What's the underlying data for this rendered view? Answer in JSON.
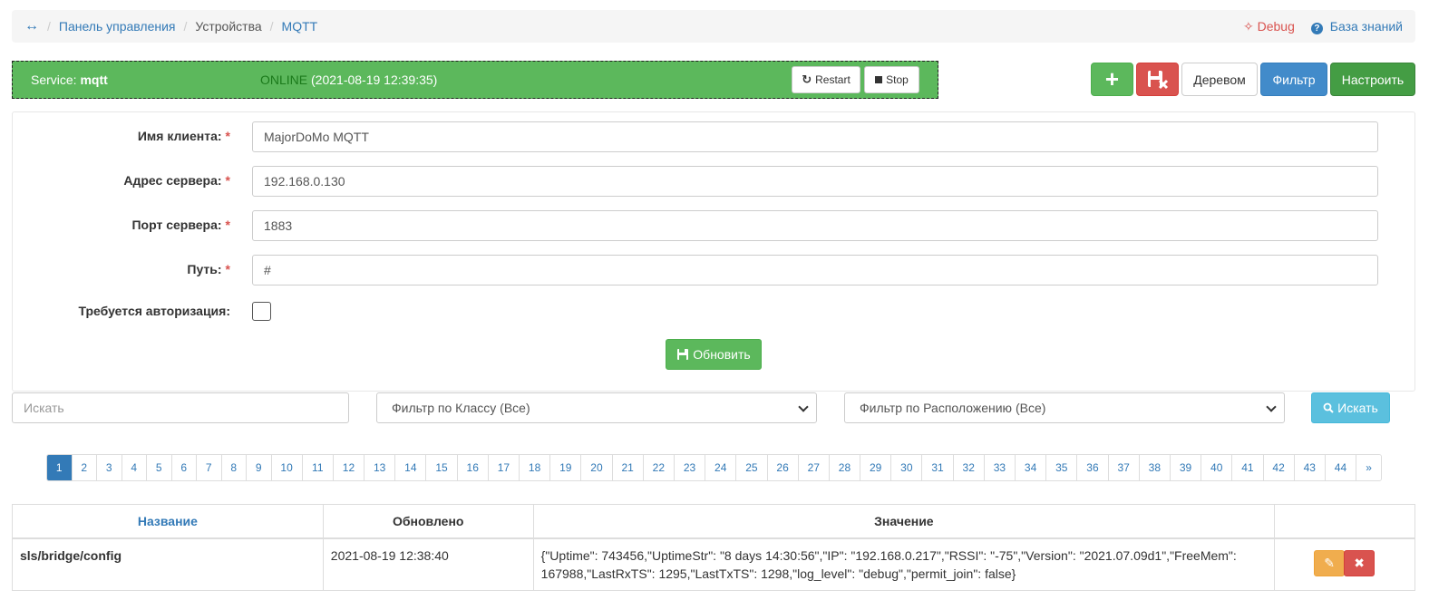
{
  "breadcrumb": {
    "home_icon": "arrows-horizontal-icon",
    "items": [
      "Панель управления",
      "Устройства",
      "MQTT"
    ],
    "debug": "Debug",
    "knowledge": "База знаний"
  },
  "service": {
    "label": "Service:",
    "name": "mqtt",
    "status": "ONLINE",
    "timestamp": "(2021-08-19 12:39:35)",
    "restart": "Restart",
    "stop": "Stop"
  },
  "toolbar": {
    "tree": "Деревом",
    "filter": "Фильтр",
    "setup": "Настроить"
  },
  "form": {
    "client_label": "Имя клиента:",
    "client_value": "MajorDoMo MQTT",
    "server_label": "Адрес сервера:",
    "server_value": "192.168.0.130",
    "port_label": "Порт сервера:",
    "port_value": "1883",
    "path_label": "Путь:",
    "path_value": "#",
    "auth_label": "Требуется авторизация:",
    "auth_checked": false,
    "update_button": "Обновить",
    "required_mark": "*"
  },
  "search": {
    "placeholder": "Искать",
    "class_filter": "Фильтр по Классу (Все)",
    "location_filter": "Фильтр по Расположению (Все)",
    "button": "Искать"
  },
  "pagination": {
    "active": "1",
    "pages": [
      "1",
      "2",
      "3",
      "4",
      "5",
      "6",
      "7",
      "8",
      "9",
      "10",
      "11",
      "12",
      "13",
      "14",
      "15",
      "16",
      "17",
      "18",
      "19",
      "20",
      "21",
      "22",
      "23",
      "24",
      "25",
      "26",
      "27",
      "28",
      "29",
      "30",
      "31",
      "32",
      "33",
      "34",
      "35",
      "36",
      "37",
      "38",
      "39",
      "40",
      "41",
      "42",
      "43",
      "44"
    ],
    "next": "»"
  },
  "table": {
    "headers": [
      "Название",
      "Обновлено",
      "Значение",
      ""
    ],
    "rows": [
      {
        "name": "sls/bridge/config",
        "updated": "2021-08-19 12:38:40",
        "value": "{\"Uptime\": 743456,\"UptimeStr\": \"8 days 14:30:56\",\"IP\": \"192.168.0.217\",\"RSSI\": \"-75\",\"Version\": \"2021.07.09d1\",\"FreeMem\": 167988,\"LastRxTS\": 1295,\"LastTxTS\": 1298,\"log_level\": \"debug\",\"permit_join\": false}"
      }
    ]
  },
  "colors": {
    "success": "#5cb85c",
    "danger": "#d9534f",
    "primary": "#428bca",
    "info": "#5bc0de",
    "warning": "#f0ad4e"
  }
}
